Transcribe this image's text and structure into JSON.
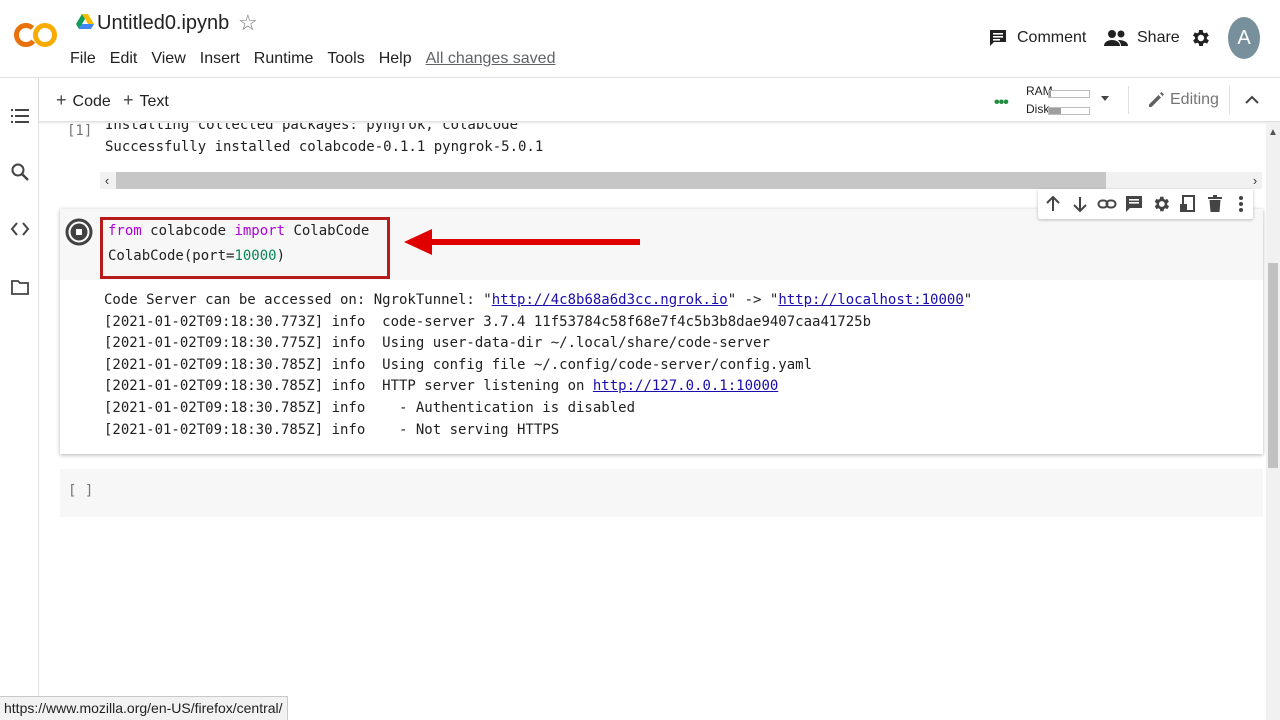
{
  "header": {
    "title": "Untitled0.ipynb",
    "menu": [
      "File",
      "Edit",
      "View",
      "Insert",
      "Runtime",
      "Tools",
      "Help"
    ],
    "save_status": "All changes saved",
    "comment_label": "Comment",
    "share_label": "Share",
    "avatar_initial": "A",
    "brand_colors": {
      "logo_orange": "#f9ab00",
      "logo_dark_orange": "#e8710a"
    }
  },
  "toolbar": {
    "add_code": "Code",
    "add_text": "Text",
    "ram_label": "RAM",
    "disk_label": "Disk",
    "ram_usage": 0.05,
    "disk_usage": 0.3,
    "editing_label": "Editing"
  },
  "notebook": {
    "previous_cell": {
      "exec_count": "[1]",
      "output_lines": [
        "Installing collected packages: pyngrok, colabcode",
        "Successfully installed colabcode-0.1.1 pyngrok-5.0.1"
      ]
    },
    "active_cell": {
      "code": {
        "line1": {
          "kw1": "from",
          "mod": " colabcode ",
          "kw2": "import",
          "name": " ColabCode"
        },
        "line2": {
          "pre": "ColabCode(port=",
          "num": "10000",
          "post": ")"
        }
      },
      "output": {
        "line0": {
          "pre": "Code Server can be accessed on: NgrokTunnel: \"",
          "link1": "http://4c8b68a6d3cc.ngrok.io",
          "mid": "\" -> \"",
          "link2": "http://localhost:10000",
          "post": "\""
        },
        "lines": [
          "[2021-01-02T09:18:30.773Z] info  code-server 3.7.4 11f53784c58f68e7f4c5b3b8dae9407caa41725b",
          "[2021-01-02T09:18:30.775Z] info  Using user-data-dir ~/.local/share/code-server",
          "[2021-01-02T09:18:30.785Z] info  Using config file ~/.config/code-server/config.yaml"
        ],
        "line4": {
          "pre": "[2021-01-02T09:18:30.785Z] info  HTTP server listening on ",
          "link": "http://127.0.0.1:10000"
        },
        "lines_tail": [
          "[2021-01-02T09:18:30.785Z] info    - Authentication is disabled",
          "[2021-01-02T09:18:30.785Z] info    - Not serving HTTPS"
        ]
      }
    },
    "empty_cell": {
      "exec_count": "[ ]"
    }
  },
  "status_url": "https://www.mozilla.org/en-US/firefox/central/",
  "annotation": {
    "color": "#e00000"
  }
}
